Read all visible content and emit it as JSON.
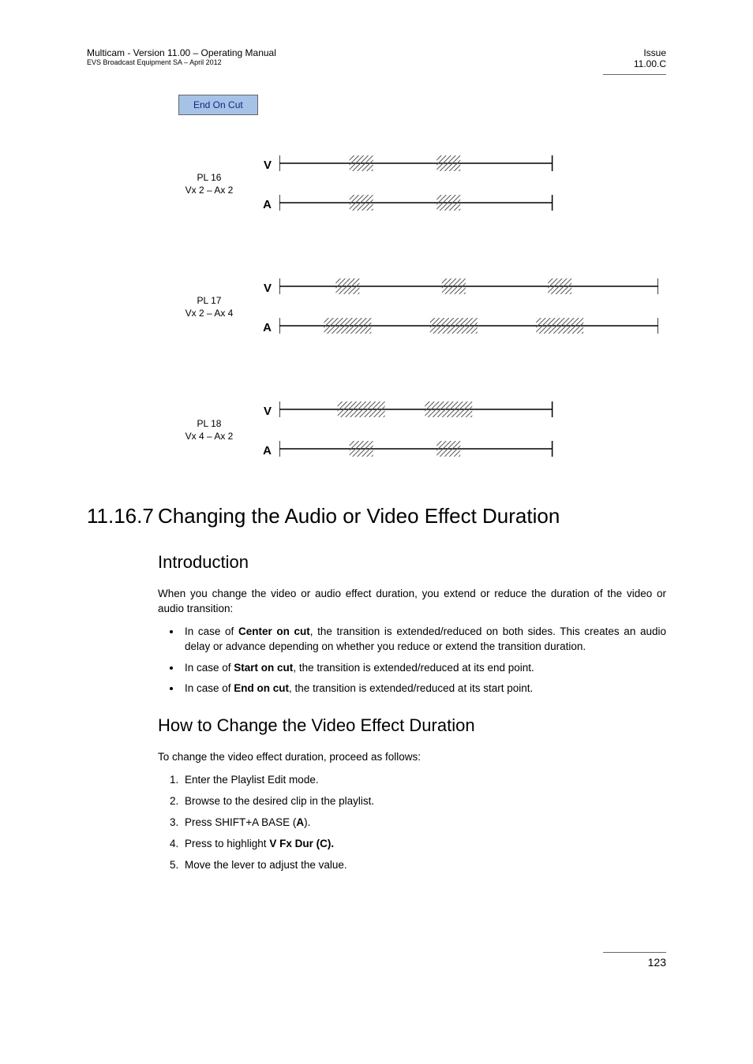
{
  "header": {
    "left_line1": "Multicam - Version 11.00 – Operating Manual",
    "left_line2": "EVS Broadcast Equipment SA – April 2012",
    "right_line1": "Issue",
    "right_line2": "11.00.C"
  },
  "diagram": {
    "button_label": "End On Cut",
    "groups": [
      {
        "pl": "PL 16",
        "vx": "Vx 2 – Ax 2",
        "v": "V",
        "a": "A",
        "v_mode": "short2",
        "a_mode": "short2"
      },
      {
        "pl": "PL 17",
        "vx": "Vx 2 – Ax 4",
        "v": "V",
        "a": "A",
        "v_mode": "short3",
        "a_mode": "long3"
      },
      {
        "pl": "PL 18",
        "vx": "Vx 4 – Ax 2",
        "v": "V",
        "a": "A",
        "v_mode": "long2",
        "a_mode": "short2"
      }
    ]
  },
  "section": {
    "number": "11.16.7",
    "title": "Changing the Audio or Video Effect Duration"
  },
  "intro": {
    "heading": "Introduction",
    "para": "When you change the video or audio effect duration, you extend or reduce the duration of the video or audio transition:",
    "bullet1_pre": "In case of ",
    "bullet1_b": "Center on cut",
    "bullet1_post": ", the transition is extended/reduced on both sides. This creates an audio delay or advance depending on whether you reduce or extend the transition duration.",
    "bullet2_pre": "In case of ",
    "bullet2_b": "Start on cut",
    "bullet2_post": ", the transition is extended/reduced at its end point.",
    "bullet3_pre": "In case of ",
    "bullet3_b": "End on cut",
    "bullet3_post": ", the transition is extended/reduced at its start point."
  },
  "howto": {
    "heading": "How to Change the Video Effect Duration",
    "para": "To change the video effect duration, proceed as follows:",
    "step1": "Enter the Playlist Edit mode.",
    "step2": "Browse to the desired clip in the playlist.",
    "step3_pre": "Press SHIFT+A BASE (",
    "step3_b": "A",
    "step3_post": ").",
    "step4_pre": "Press to highlight ",
    "step4_b": "V Fx Dur (C).",
    "step5": "Move the lever to adjust the value."
  },
  "page_number": "123"
}
